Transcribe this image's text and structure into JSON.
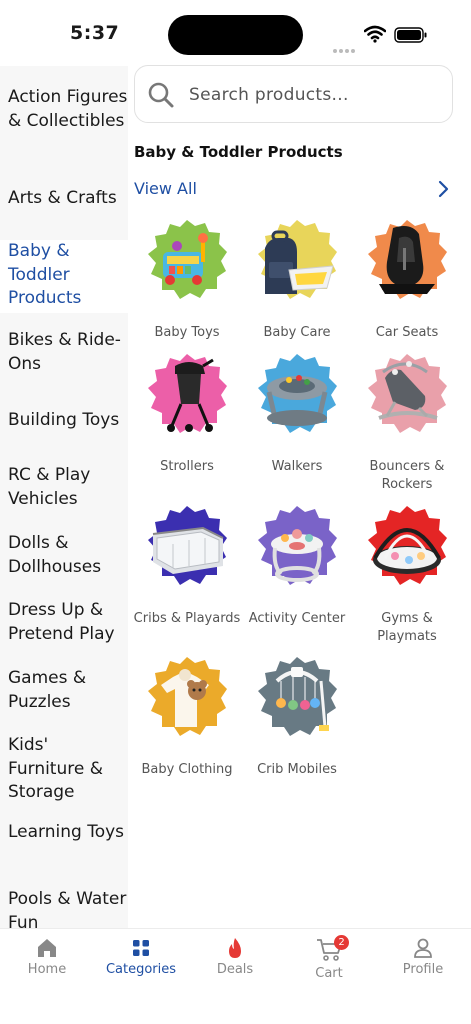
{
  "status": {
    "time": "5:37"
  },
  "sidebar": {
    "items": [
      {
        "label": "Action Figures & Collectibles",
        "active": false
      },
      {
        "label": "Arts & Crafts",
        "active": false
      },
      {
        "label": "Baby & Toddler Products",
        "active": true
      },
      {
        "label": "Bikes & Ride-Ons",
        "active": false
      },
      {
        "label": "Building Toys",
        "active": false
      },
      {
        "label": "RC & Play Vehicles",
        "active": false
      },
      {
        "label": "Dolls & Dollhouses",
        "active": false
      },
      {
        "label": "Dress Up & Pretend Play",
        "active": false
      },
      {
        "label": "Games & Puzzles",
        "active": false
      },
      {
        "label": "Kids' Furniture & Storage",
        "active": false
      },
      {
        "label": "Learning Toys",
        "active": false
      },
      {
        "label": "Pools & Water Fun",
        "active": false
      }
    ]
  },
  "search": {
    "placeholder": "Search products..."
  },
  "main": {
    "section_title": "Baby & Toddler Products",
    "view_all": "View All",
    "categories": [
      {
        "label": "Baby Toys",
        "icon": "baby-toys-image",
        "color": "#8bc34a"
      },
      {
        "label": "Baby Care",
        "icon": "baby-care-image",
        "color": "#e8d55a"
      },
      {
        "label": "Car Seats",
        "icon": "car-seats-image",
        "color": "#f08a4b"
      },
      {
        "label": "Strollers",
        "icon": "strollers-image",
        "color": "#ec5fa8"
      },
      {
        "label": "Walkers",
        "icon": "walkers-image",
        "color": "#4aa8dc"
      },
      {
        "label": "Bouncers & Rockers",
        "icon": "bouncers-image",
        "color": "#e9a0aa"
      },
      {
        "label": "Cribs & Playards",
        "icon": "cribs-image",
        "color": "#3b2fb0"
      },
      {
        "label": "Activity Center",
        "icon": "activity-center-image",
        "color": "#7a63c8"
      },
      {
        "label": "Gyms & Playmats",
        "icon": "gyms-image",
        "color": "#e42525"
      },
      {
        "label": "Baby Clothing",
        "icon": "baby-clothing-image",
        "color": "#ebaa2a"
      },
      {
        "label": "Crib Mobiles",
        "icon": "crib-mobiles-image",
        "color": "#687a84"
      }
    ]
  },
  "bottom_nav": {
    "items": [
      {
        "label": "Home",
        "icon": "home-icon"
      },
      {
        "label": "Categories",
        "icon": "grid-icon"
      },
      {
        "label": "Deals",
        "icon": "flame-icon"
      },
      {
        "label": "Cart",
        "icon": "cart-icon",
        "badge": "2"
      },
      {
        "label": "Profile",
        "icon": "person-icon"
      }
    ]
  },
  "colors": {
    "accent": "#1f4fa3",
    "deal": "#e53935"
  }
}
